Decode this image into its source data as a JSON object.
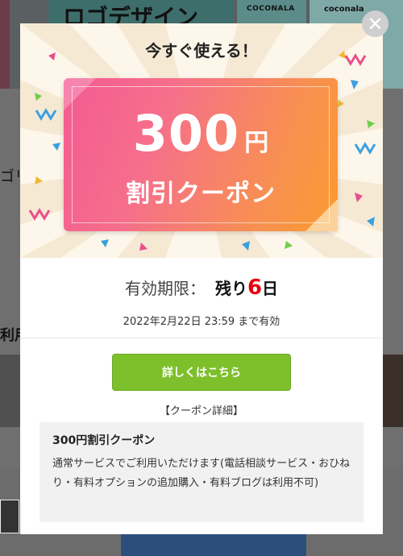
{
  "background": {
    "logo_text": "ロゴデザイン",
    "tile_brand_1": "COCONALA",
    "tile_brand_2": "coconala",
    "side_text_1": "ゴリ",
    "side_text_2": "利用"
  },
  "modal": {
    "headline": "今すぐ使える！",
    "coupon": {
      "amount": "300",
      "unit": "円",
      "label": "割引クーポン"
    },
    "expiry": {
      "label": "有効期限：",
      "prefix": "残り",
      "days": "6",
      "suffix": "日"
    },
    "deadline": "2022年2月22日 23:59 まで有効",
    "cta_label": "詳しくはこちら",
    "detail_heading": "【クーポン詳細】",
    "detail": {
      "title": "300円割引クーポン",
      "body": "通常サービスでご利用いただけます(電話相談サービス・おひねり・有料オプションの追加購入・有料ブログは利用不可)"
    },
    "close_icon": "close-icon"
  },
  "colors": {
    "coupon_gradient_start": "#f45a93",
    "coupon_gradient_end": "#fb9a30",
    "cta_green": "#7ebf2c",
    "days_red": "#e60012"
  }
}
